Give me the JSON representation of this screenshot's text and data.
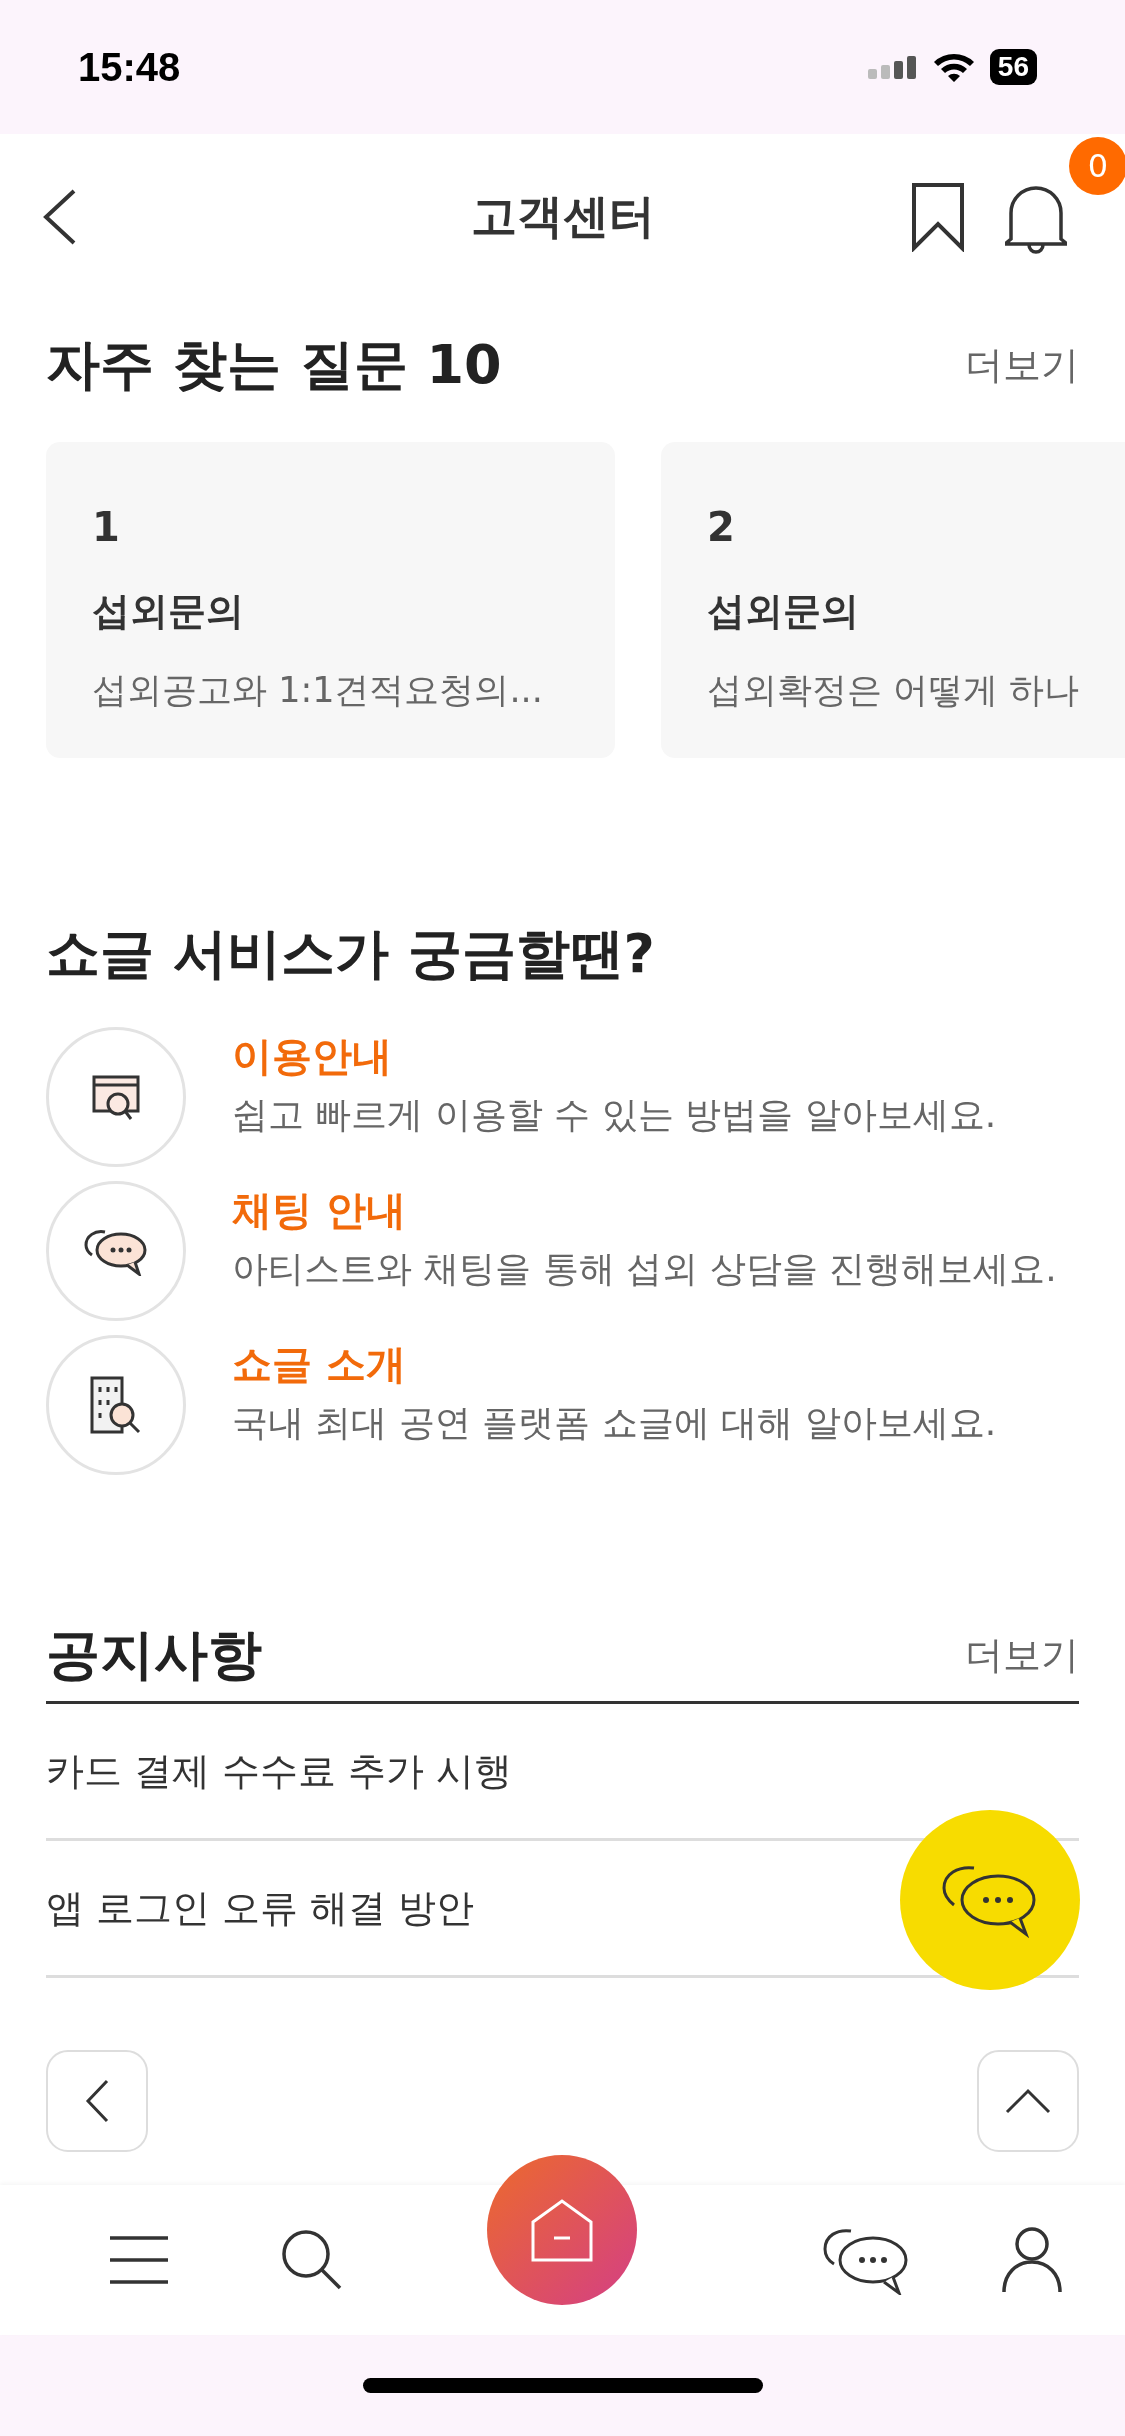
{
  "status_bar": {
    "time": "15:48",
    "battery": "56"
  },
  "header": {
    "title": "고객센터",
    "notification_count": "0"
  },
  "faq": {
    "title": "자주 찾는 질문 10",
    "more": "더보기",
    "cards": [
      {
        "number": "1",
        "category": "섭외문의",
        "question": "섭외공고와 1:1견적요청의..."
      },
      {
        "number": "2",
        "category": "섭외문의",
        "question": "섭외확정은 어떻게 하나"
      }
    ]
  },
  "guide": {
    "title": "쇼글 서비스가 궁금할땐?",
    "items": [
      {
        "kind": "usage",
        "title": "이용안내",
        "description": "쉽고 빠르게 이용할 수 있는 방법을 알아보세요."
      },
      {
        "kind": "chat",
        "title": "채팅 안내",
        "description": "아티스트와 채팅을 통해 섭외 상담을 진행해보세요."
      },
      {
        "kind": "company",
        "title": "쇼글 소개",
        "description": "국내 최대 공연 플랫폼 쇼글에 대해 알아보세요."
      }
    ]
  },
  "notices": {
    "title": "공지사항",
    "more": "더보기",
    "items": [
      {
        "title": "카드 결제 수수료 추가 시행"
      },
      {
        "title": "앱 로그인 오류 해결 방안"
      }
    ]
  }
}
